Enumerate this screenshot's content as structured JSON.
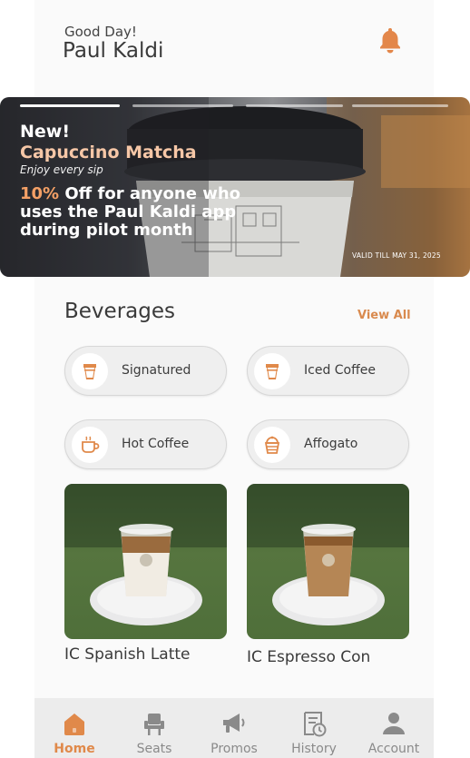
{
  "header": {
    "greeting": "Good Day!",
    "user_name": "Paul Kaldi"
  },
  "banner": {
    "slides_total": 4,
    "active_slide": 1,
    "tag": "New!",
    "product": "Capuccino Matcha",
    "tagline": "Enjoy every sip",
    "offer_percent": "10%",
    "offer_line1": " Off for anyone who",
    "offer_line2": "uses the Paul Kaldi app",
    "offer_line3": "during pilot month",
    "validity": "VALID TILL MAY 31, 2025"
  },
  "beverages": {
    "title": "Beverages",
    "view_all": "View All",
    "categories": [
      {
        "label": "Signatured",
        "icon": "cup-icon"
      },
      {
        "label": "Iced Coffee",
        "icon": "cup-icon"
      },
      {
        "label": "Hot Coffee",
        "icon": "mug-icon"
      },
      {
        "label": "Affogato",
        "icon": "dessert-cup-icon"
      }
    ],
    "products": [
      {
        "name": "IC Spanish Latte"
      },
      {
        "name": "IC Espresso Con"
      }
    ]
  },
  "nav": {
    "items": [
      {
        "label": "Home",
        "icon": "home-icon",
        "active": true
      },
      {
        "label": "Seats",
        "icon": "seat-icon",
        "active": false
      },
      {
        "label": "Promos",
        "icon": "megaphone-icon",
        "active": false
      },
      {
        "label": "History",
        "icon": "history-icon",
        "active": false
      },
      {
        "label": "Account",
        "icon": "user-icon",
        "active": false
      }
    ]
  },
  "colors": {
    "accent": "#e0894a",
    "chip_bg": "#efefef",
    "nav_bg": "#ececec"
  }
}
